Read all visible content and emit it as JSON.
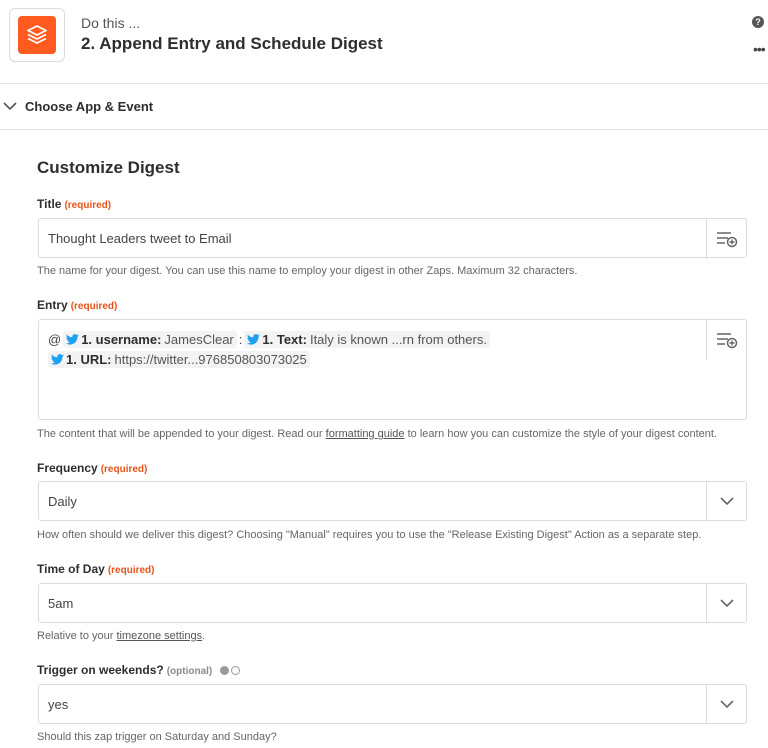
{
  "header": {
    "subtitle": "Do this ...",
    "title": "2. Append Entry and Schedule Digest",
    "help_icon": "?",
    "more_icon": "•••"
  },
  "section": {
    "label": "Choose App & Event"
  },
  "form": {
    "title": "Customize Digest",
    "title_field": {
      "label": "Title",
      "required": "(required)",
      "value": "Thought Leaders tweet to Email",
      "help": "The name for your digest. You can use this name to employ your digest in other Zaps. Maximum 32 characters."
    },
    "entry_field": {
      "label": "Entry",
      "required": "(required)",
      "prefix": "@",
      "pill1_label": "1. username:",
      "pill1_value": "JamesClear",
      "separator": ":",
      "pill2_label": "1. Text:",
      "pill2_value": "Italy is known ...rn from others.",
      "pill3_label": "1. URL:",
      "pill3_value": "https://twitter...976850803073025",
      "help_before": "The content that will be appended to your digest. Read our ",
      "help_link": "formatting guide",
      "help_after": " to learn how you can customize the style of your digest content."
    },
    "frequency_field": {
      "label": "Frequency",
      "required": "(required)",
      "value": "Daily",
      "help": "How often should we deliver this digest? Choosing \"Manual\" requires you to use the \"Release Existing Digest\" Action as a separate step."
    },
    "time_field": {
      "label": "Time of Day",
      "required": "(required)",
      "value": "5am",
      "help_before": "Relative to your ",
      "help_link": "timezone settings",
      "help_after": "."
    },
    "weekends_field": {
      "label": "Trigger on weekends?",
      "optional": "(optional)",
      "value": "yes",
      "help": "Should this zap trigger on Saturday and Sunday?"
    }
  },
  "colors": {
    "brand": "#ff5a1f",
    "required": "#e5531b",
    "twitter": "#1da1f2"
  },
  "icons": [
    "digest-app-icon",
    "help-icon",
    "more-icon",
    "chevron-down-icon",
    "insert-field-icon",
    "twitter-icon"
  ]
}
